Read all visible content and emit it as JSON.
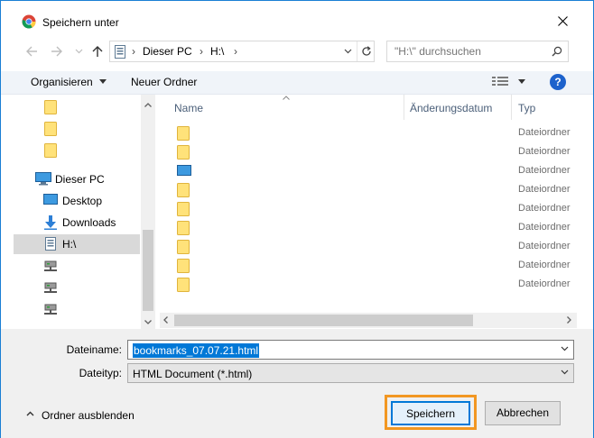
{
  "window": {
    "title": "Speichern unter",
    "accent_color": "#1a7fd4",
    "title_icon": "chrome-icon",
    "close_icon": "close-icon"
  },
  "address_bar": {
    "breadcrumb": [
      "Dieser PC",
      "H:\\"
    ],
    "search_placeholder": "\"H:\\\" durchsuchen"
  },
  "toolbar": {
    "organize_label": "Organisieren",
    "new_folder_label": "Neuer Ordner",
    "help_label": "?"
  },
  "nav_pane": {
    "items": [
      {
        "label": "",
        "icon": "folder-icon"
      },
      {
        "label": "",
        "icon": "folder-icon"
      },
      {
        "label": "",
        "icon": "folder-icon"
      },
      {
        "label": "Dieser PC",
        "icon": "pc-icon"
      },
      {
        "label": "Desktop",
        "icon": "desktop-icon"
      },
      {
        "label": "Downloads",
        "icon": "download-icon"
      },
      {
        "label": "H:\\",
        "icon": "drive-icon",
        "selected": true
      },
      {
        "label": "",
        "icon": "network-drive-icon"
      },
      {
        "label": "",
        "icon": "network-drive-icon"
      },
      {
        "label": "",
        "icon": "network-drive-icon"
      }
    ]
  },
  "file_list": {
    "columns": [
      "Name",
      "Änderungsdatum",
      "Typ"
    ],
    "rows": [
      {
        "name": "",
        "type": "Dateiordner",
        "icon": "folder-icon"
      },
      {
        "name": "",
        "type": "Dateiordner",
        "icon": "folder-icon"
      },
      {
        "name": "",
        "type": "Dateiordner",
        "icon": "desktop-folder-icon"
      },
      {
        "name": "",
        "type": "Dateiordner",
        "icon": "folder-icon"
      },
      {
        "name": "",
        "type": "Dateiordner",
        "icon": "folder-icon"
      },
      {
        "name": "",
        "type": "Dateiordner",
        "icon": "folder-icon"
      },
      {
        "name": "",
        "type": "Dateiordner",
        "icon": "folder-icon"
      },
      {
        "name": "",
        "type": "Dateiordner",
        "icon": "folder-icon"
      },
      {
        "name": "",
        "type": "Dateiordner",
        "icon": "folder-icon"
      }
    ]
  },
  "form": {
    "filename_label": "Dateiname:",
    "filename_value": "bookmarks_07.07.21.html",
    "filetype_label": "Dateityp:",
    "filetype_value": "HTML Document (*.html)",
    "hide_folders_label": "Ordner ausblenden",
    "save_label": "Speichern",
    "cancel_label": "Abbrechen",
    "highlight_color": "#f29722"
  }
}
